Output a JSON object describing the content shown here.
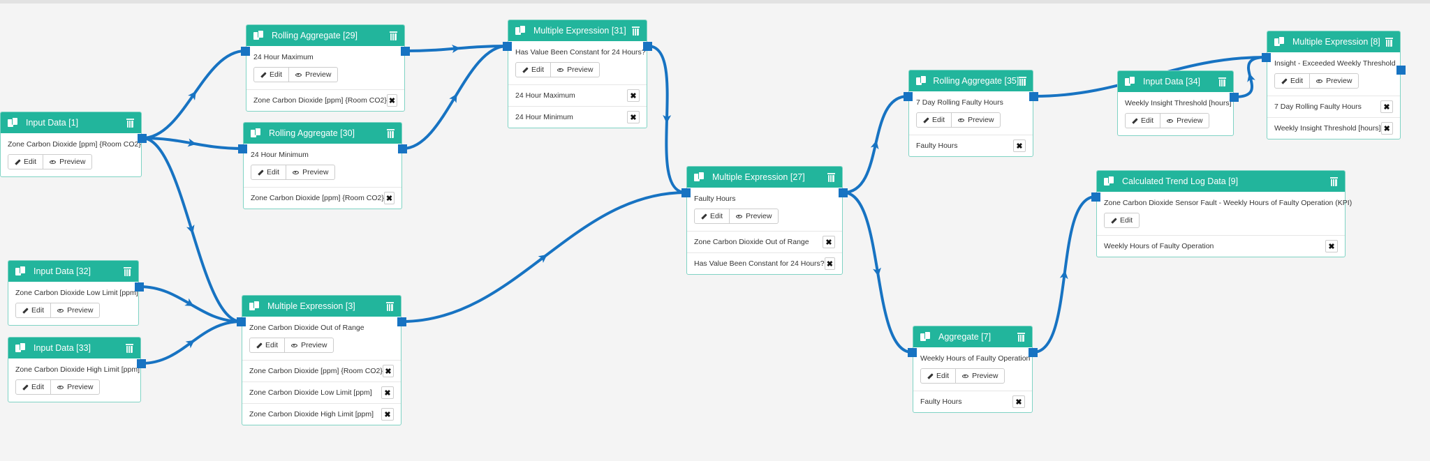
{
  "colors": {
    "header": "#22b59c",
    "wire": "#1773c2",
    "border": "#7fd3c4",
    "background": "#f4f4f4"
  },
  "buttons": {
    "edit": "Edit",
    "preview": "Preview"
  },
  "icons": {
    "node": "copy-icon",
    "delete": "trash-icon",
    "edit": "pencil-icon",
    "preview": "eye-icon",
    "remove_input": "close-icon"
  },
  "nodes": {
    "n1": {
      "title": "Input Data [1]",
      "name": "Zone Carbon Dioxide [ppm] {Room CO2}",
      "inputs": []
    },
    "n29": {
      "title": "Rolling Aggregate [29]",
      "name": "24 Hour Maximum",
      "inputs": [
        "Zone Carbon Dioxide [ppm] {Room CO2}"
      ]
    },
    "n30": {
      "title": "Rolling Aggregate [30]",
      "name": "24 Hour Minimum",
      "inputs": [
        "Zone Carbon Dioxide [ppm] {Room CO2}"
      ]
    },
    "n31": {
      "title": "Multiple Expression [31]",
      "name": "Has Value Been Constant for 24 Hours?",
      "inputs": [
        "24 Hour Maximum",
        "24 Hour Minimum"
      ]
    },
    "n32": {
      "title": "Input Data [32]",
      "name": "Zone Carbon Dioxide Low Limit [ppm]",
      "inputs": []
    },
    "n33": {
      "title": "Input Data [33]",
      "name": "Zone Carbon Dioxide High Limit [ppm]",
      "inputs": []
    },
    "n3": {
      "title": "Multiple Expression [3]",
      "name": "Zone Carbon Dioxide Out of Range",
      "inputs": [
        "Zone Carbon Dioxide [ppm] {Room CO2}",
        "Zone Carbon Dioxide Low Limit [ppm]",
        "Zone Carbon Dioxide High Limit [ppm]"
      ]
    },
    "n27": {
      "title": "Multiple Expression [27]",
      "name": "Faulty Hours",
      "inputs": [
        "Zone Carbon Dioxide Out of Range",
        "Has Value Been Constant for 24 Hours?"
      ]
    },
    "n35": {
      "title": "Rolling Aggregate [35]",
      "name": "7 Day Rolling Faulty Hours",
      "inputs": [
        "Faulty Hours"
      ]
    },
    "n7": {
      "title": "Aggregate [7]",
      "name": "Weekly Hours of Faulty Operation",
      "inputs": [
        "Faulty Hours"
      ]
    },
    "n34": {
      "title": "Input Data [34]",
      "name": "Weekly Insight Threshold [hours]",
      "inputs": []
    },
    "n8": {
      "title": "Multiple Expression [8]",
      "name": "Insight - Exceeded Weekly Threshold",
      "inputs": [
        "7 Day Rolling Faulty Hours",
        "Weekly Insight Threshold [hours]"
      ]
    },
    "n9": {
      "title": "Calculated Trend Log Data [9]",
      "name": "Zone Carbon Dioxide Sensor Fault - Weekly Hours of Faulty Operation (KPI)",
      "inputs": [
        "Weekly Hours of Faulty Operation"
      ]
    }
  },
  "connections": [
    [
      "n1",
      "n29"
    ],
    [
      "n1",
      "n30"
    ],
    [
      "n1",
      "n3"
    ],
    [
      "n32",
      "n3"
    ],
    [
      "n33",
      "n3"
    ],
    [
      "n29",
      "n31"
    ],
    [
      "n30",
      "n31"
    ],
    [
      "n31",
      "n27"
    ],
    [
      "n3",
      "n27"
    ],
    [
      "n27",
      "n35"
    ],
    [
      "n27",
      "n7"
    ],
    [
      "n35",
      "n8"
    ],
    [
      "n34",
      "n8"
    ],
    [
      "n7",
      "n9"
    ]
  ]
}
